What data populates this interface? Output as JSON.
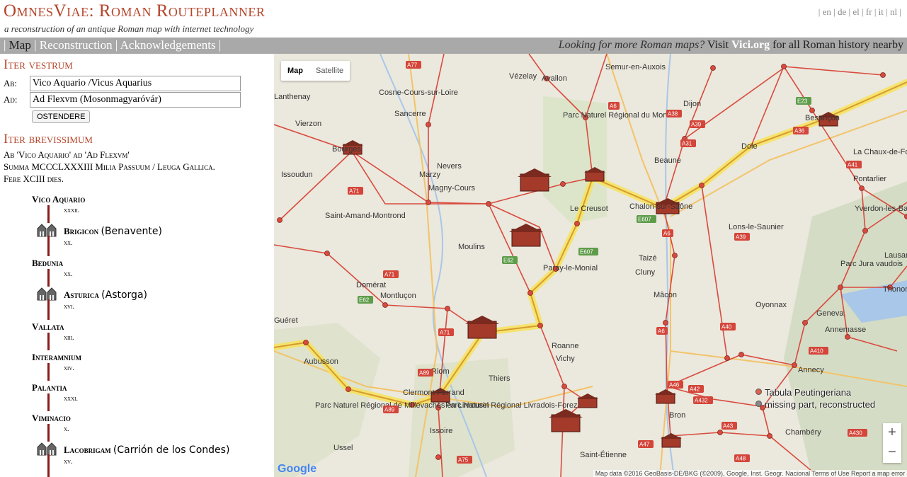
{
  "header": {
    "title": "OmnesViae: Roman Routeplanner",
    "subtitle": "a reconstruction of an antique Roman map with internet technology",
    "languages": [
      "en",
      "de",
      "el",
      "fr",
      "it",
      "nl"
    ]
  },
  "nav": {
    "items": [
      "Map",
      "Reconstruction",
      "Acknowledgements"
    ],
    "promo_question": "Looking for more Roman maps?",
    "promo_visit": "Visit",
    "promo_site": "Vici.org",
    "promo_tail": "for all Roman history nearby"
  },
  "form": {
    "heading": "Iter vestrum",
    "from_label": "Ab:",
    "from_value": "Vico Aquario /Vicus Aquarius",
    "to_label": "Ad:",
    "to_value": "Ad Flexvm (Mosonmagyaróvár)",
    "submit_label": "OSTENDERE"
  },
  "result": {
    "heading": "Iter brevissimum",
    "line1": "Ab 'Vico Aquario' ad 'Ad Flexvm'",
    "line2": "Summa MCCCLXXXIII Milia Passuum / Leuga Gallica.",
    "line3": "Fere XCIII dies."
  },
  "route": [
    {
      "name": "Vico Aquario",
      "modern": "",
      "icon": false,
      "dist": "xxxii."
    },
    {
      "name": "Brigicon",
      "modern": "(Benavente)",
      "icon": true,
      "dist": "xx."
    },
    {
      "name": "Bedunia",
      "modern": "",
      "icon": false,
      "dist": "xx."
    },
    {
      "name": "Asturica",
      "modern": "(Astorga)",
      "icon": true,
      "dist": "xvi."
    },
    {
      "name": "Vallata",
      "modern": "",
      "icon": false,
      "dist": "xiii."
    },
    {
      "name": "Interamnium",
      "modern": "",
      "icon": false,
      "dist": "xiv."
    },
    {
      "name": "Palantia",
      "modern": "",
      "icon": false,
      "dist": "xxxi."
    },
    {
      "name": "Viminacio",
      "modern": "",
      "icon": false,
      "dist": "x."
    },
    {
      "name": "Lacobrigam",
      "modern": "(Carrión de los Condes)",
      "icon": true,
      "dist": "xv."
    }
  ],
  "map": {
    "type_buttons": [
      "Map",
      "Satellite"
    ],
    "legend": [
      "Tabula Peutingeriana",
      "missing part, reconstructed"
    ],
    "legend_colors": [
      "#e06050",
      "#888888"
    ],
    "zoom_in": "+",
    "zoom_out": "−",
    "attribution": "Map data ©2016 GeoBasis-DE/BKG (©2009), Google, Inst. Geogr. Nacional   Terms of Use   Report a map error",
    "google": "Google",
    "places": [
      "Vézelay",
      "Avallon",
      "Semur-en-Auxois",
      "Cosne-Cours-sur-Loire",
      "Sancerre",
      "Lanthenay",
      "Vierzon",
      "Parc Naturel Régional du Morvan",
      "Dijon",
      "Besançon",
      "Dole",
      "La Chaux-de-Fonds",
      "Bourges",
      "Nevers",
      "Marzy",
      "Magny-Cours",
      "Issoudun",
      "Beaune",
      "Chalon-sur-Saône",
      "Le Creusot",
      "Saint-Amand-Montrond",
      "Moulins",
      "Paray-le-Monial",
      "Lons-le-Saunier",
      "Yverdon-les-Bains",
      "Pontarlier",
      "Domérat",
      "Montluçon",
      "Taizé",
      "Cluny",
      "Mâcon",
      "Lausanne",
      "Parc Jura vaudois",
      "Thonon",
      "Oyonnax",
      "Geneva",
      "Annemasse",
      "Guéret",
      "Roanne",
      "Vichy",
      "Thiers",
      "Riom",
      "Clermont-Ferrand",
      "Aubusson",
      "Annecy",
      "Parc Naturel Régional de Millevaches en Limousin",
      "Parc Naturel Régional Livradois-Forez",
      "Issoire",
      "Ussel",
      "Saint-Étienne",
      "Bron",
      "Chambéry"
    ],
    "highways": [
      "A77",
      "A6",
      "A38",
      "A31",
      "A39",
      "A36",
      "E23",
      "A71",
      "E607",
      "A6",
      "A39",
      "E62",
      "A71",
      "E62",
      "A71",
      "A89",
      "A89",
      "A40",
      "A410",
      "A46",
      "A42",
      "A432",
      "A43",
      "A47",
      "A75",
      "A48",
      "A41",
      "A430",
      "E607",
      "A6"
    ]
  }
}
